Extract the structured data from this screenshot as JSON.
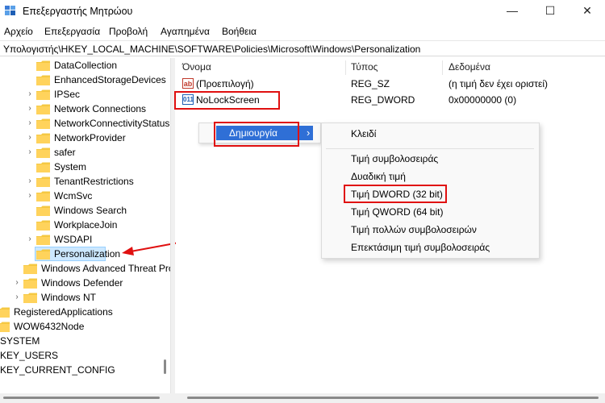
{
  "window": {
    "title": "Επεξεργαστής Μητρώου",
    "minimize": "—",
    "maximize": "☐",
    "close": "✕",
    "icon": "registry-editor-icon"
  },
  "menu": [
    "Αρχείο",
    "Επεξεργασία",
    "Προβολή",
    "Αγαπημένα",
    "Βοήθεια"
  ],
  "address": "Υπολογιστής\\HKEY_LOCAL_MACHINE\\SOFTWARE\\Policies\\Microsoft\\Windows\\Personalization",
  "tree": [
    {
      "label": "DataCollection",
      "chevron": ""
    },
    {
      "label": "EnhancedStorageDevices",
      "chevron": ""
    },
    {
      "label": "IPSec",
      "chevron": "›"
    },
    {
      "label": "Network Connections",
      "chevron": "›"
    },
    {
      "label": "NetworkConnectivityStatusIndicator",
      "chevron": "›"
    },
    {
      "label": "NetworkProvider",
      "chevron": "›"
    },
    {
      "label": "safer",
      "chevron": "›"
    },
    {
      "label": "System",
      "chevron": ""
    },
    {
      "label": "TenantRestrictions",
      "chevron": "›"
    },
    {
      "label": "WcmSvc",
      "chevron": "›"
    },
    {
      "label": "Windows Search",
      "chevron": ""
    },
    {
      "label": "WorkplaceJoin",
      "chevron": ""
    },
    {
      "label": "WSDAPI",
      "chevron": "›"
    },
    {
      "label": "Personalization",
      "chevron": ""
    },
    {
      "label": "Windows Advanced Threat Protection",
      "chevron": ""
    },
    {
      "label": "Windows Defender",
      "chevron": "›"
    },
    {
      "label": "Windows NT",
      "chevron": "›"
    },
    {
      "label": "RegisteredApplications",
      "chevron": ""
    },
    {
      "label": "WOW6432Node",
      "chevron": "›"
    },
    {
      "label": "SYSTEM",
      "chevron": ""
    },
    {
      "label": "KEY_USERS",
      "chevron": ""
    },
    {
      "label": "KEY_CURRENT_CONFIG",
      "chevron": ""
    }
  ],
  "columns": {
    "name": "Όνομα",
    "type": "Τύπος",
    "data": "Δεδομένα"
  },
  "values": [
    {
      "name": "(Προεπιλογή)",
      "type": "REG_SZ",
      "data": "(η τιμή δεν έχει οριστεί)",
      "icon": "ab"
    },
    {
      "name": "NoLockScreen",
      "type": "REG_DWORD",
      "data": "0x00000000 (0)",
      "icon": "011"
    }
  ],
  "context_menu": {
    "create": "Δημιουργία",
    "submenu_arrow": "›",
    "items": [
      "Κλειδί",
      "Τιμή συμβολοσειράς",
      "Δυαδική τιμή",
      "Τιμή DWORD (32 bit)",
      "Τιμή QWORD (64 bit)",
      "Τιμή πολλών συμβολοσειρών",
      "Επεκτάσιμη τιμή συμβολοσειράς"
    ]
  },
  "colors": {
    "highlight_red": "#e01010",
    "menu_highlight": "#2f6fd6",
    "folder": "#f5c842",
    "selection": "#cce8ff"
  }
}
